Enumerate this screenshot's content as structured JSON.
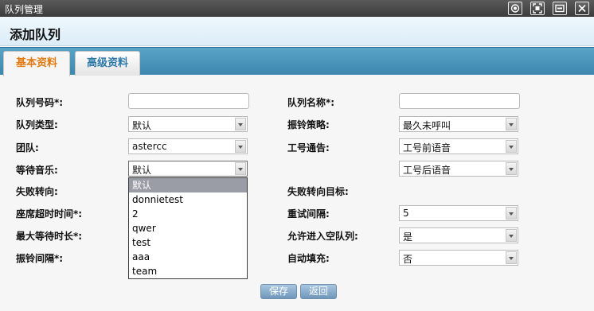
{
  "window": {
    "title": "队列管理",
    "buttons": [
      "record-icon",
      "fullscreen-icon",
      "minimize-icon",
      "close-icon"
    ]
  },
  "page_title": "添加队列",
  "tabs": [
    {
      "label": "基本资料",
      "active": true
    },
    {
      "label": "高级资料",
      "active": false
    }
  ],
  "form": {
    "queue_number": {
      "label": "队列号码*:",
      "value": ""
    },
    "queue_name": {
      "label": "队列名称*:",
      "value": ""
    },
    "queue_type": {
      "label": "队列类型:",
      "value": "默认"
    },
    "ring_strategy": {
      "label": "振铃策略:",
      "value": "最久未呼叫"
    },
    "team": {
      "label": "团队:",
      "value": "astercc"
    },
    "agent_announce": {
      "label": "工号通告:",
      "value": "工号前语音"
    },
    "agent_announce_after": {
      "value": "工号后语音"
    },
    "hold_music": {
      "label": "等待音乐:",
      "value": "默认"
    },
    "fail_route": {
      "label": "失败转向:"
    },
    "fail_target": {
      "label": "失败转向目标:"
    },
    "seat_timeout": {
      "label": "座席超时时间*:"
    },
    "retry_interval": {
      "label": "重试间隔:",
      "value": "5"
    },
    "max_wait": {
      "label": "最大等待时长*:"
    },
    "allow_empty": {
      "label": "允许进入空队列:",
      "value": "是"
    },
    "ring_interval": {
      "label": "振铃间隔*:"
    },
    "auto_fill": {
      "label": "自动填充:",
      "value": "否"
    }
  },
  "dropdown_options": [
    {
      "label": "默认",
      "selected": true
    },
    {
      "label": "donnietest",
      "selected": false
    },
    {
      "label": "2",
      "selected": false
    },
    {
      "label": "qwer",
      "selected": false
    },
    {
      "label": "test",
      "selected": false
    },
    {
      "label": "aaa",
      "selected": false
    },
    {
      "label": "team",
      "selected": false
    }
  ],
  "actions": {
    "save": "保存",
    "back": "返回"
  }
}
